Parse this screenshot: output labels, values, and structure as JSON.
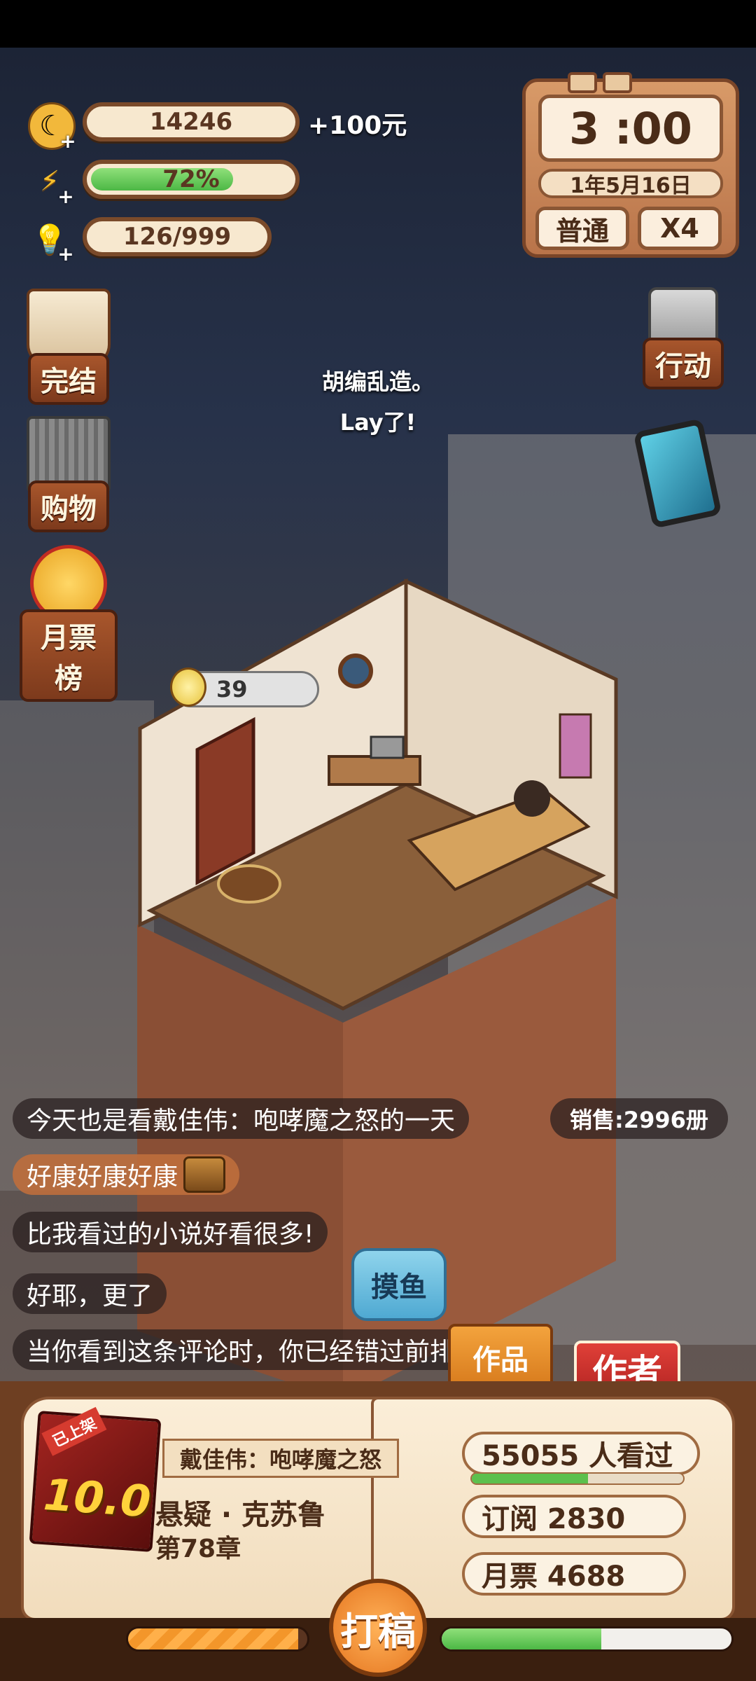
{
  "resources": {
    "coins": "14246",
    "bonus": "+100元",
    "energy": {
      "label": "72%",
      "fraction": 0.72
    },
    "ideas": "126/999"
  },
  "clock": {
    "time": "3 :00",
    "date": "1年5月16日",
    "mode": "普通",
    "speed": "X4"
  },
  "left_menu": [
    "完结",
    "购物",
    "月票榜"
  ],
  "right_menu": {
    "action": "行动"
  },
  "center_text": [
    "胡编乱造。",
    "Lay了!"
  ],
  "idea_bubble": "39",
  "comments": [
    "今天也是看戴佳伟：咆哮魔之怒的一天",
    "好康好康好康",
    "比我看过的小说好看很多!",
    "好耶，更了",
    "当你看到这条评论时，你已经错过前排了"
  ],
  "sales": "销售:2996册",
  "buttons": {
    "moyu": "摸鱼",
    "author": "作者",
    "works": "作品",
    "write": "打稿"
  },
  "book": {
    "badge": "已上架",
    "score": "10.0",
    "title": "戴佳伟：咆哮魔之怒",
    "genre": "悬疑 · 克苏鲁",
    "chapter": "第78章",
    "readers": "55055  人看过",
    "readers_progress": 0.55,
    "subscriptions": "订阅 2830",
    "monthly_votes": "月票 4688",
    "left_progress": 0.95,
    "right_progress": 0.55
  },
  "colors": {
    "energy": "#4cb845",
    "accent": "#e57620",
    "author": "#d63b2f"
  }
}
